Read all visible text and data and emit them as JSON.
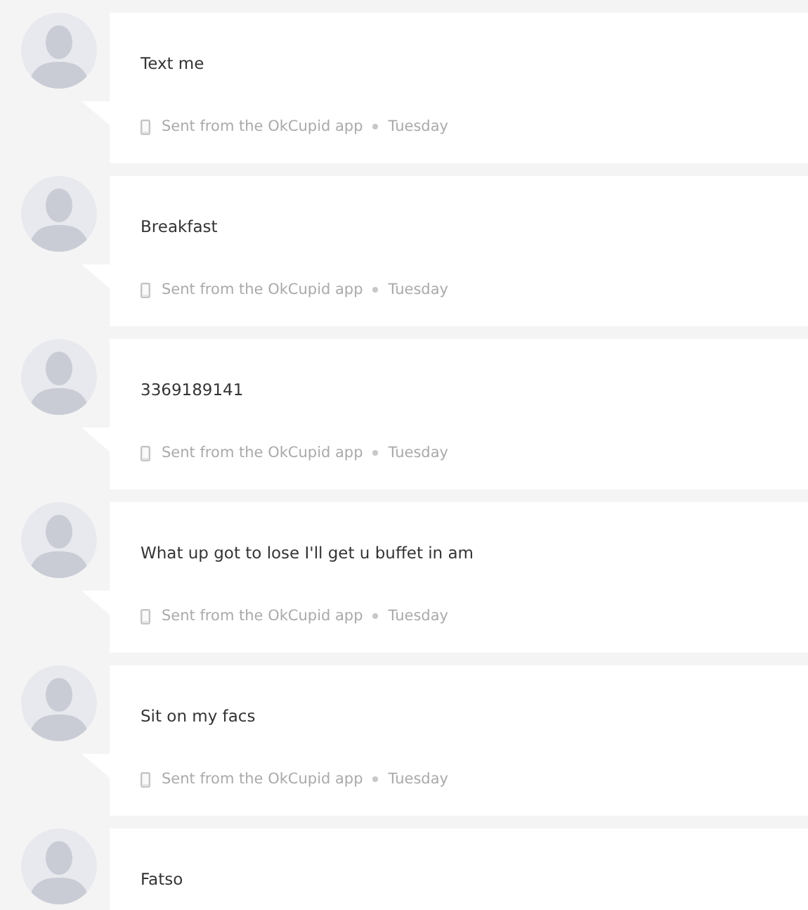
{
  "messages": [
    {
      "text": "Text me",
      "source": "Sent from the OkCupid app",
      "time": "Tuesday"
    },
    {
      "text": "Breakfast",
      "source": "Sent from the OkCupid app",
      "time": "Tuesday"
    },
    {
      "text": "3369189141",
      "source": "Sent from the OkCupid app",
      "time": "Tuesday"
    },
    {
      "text": "What up got to lose I'll get u buffet in am",
      "source": "Sent from the OkCupid app",
      "time": "Tuesday"
    },
    {
      "text": "Sit on my facs",
      "source": "Sent from the OkCupid app",
      "time": "Tuesday"
    },
    {
      "text": "Fatso"
    }
  ]
}
